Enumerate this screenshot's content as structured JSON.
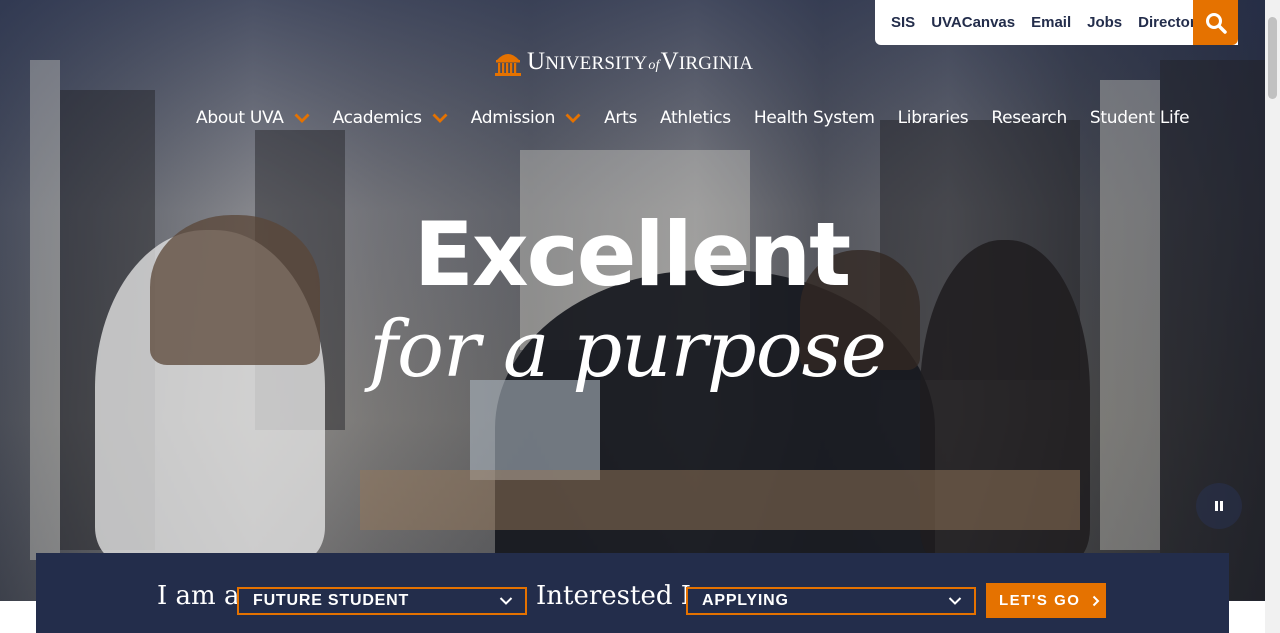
{
  "utility_nav": {
    "links": [
      "SIS",
      "UVACanvas",
      "Email",
      "Jobs",
      "Directory"
    ],
    "search_icon": "search-icon"
  },
  "logo": {
    "part1_big": "U",
    "part1_small": "NIVERSITY",
    "of": "of",
    "part2_big": "V",
    "part2_small": "IRGINIA"
  },
  "main_nav": {
    "items": [
      {
        "label": "About UVA",
        "has_dropdown": true
      },
      {
        "label": "Academics",
        "has_dropdown": true
      },
      {
        "label": "Admission",
        "has_dropdown": true
      },
      {
        "label": "Arts",
        "has_dropdown": false
      },
      {
        "label": "Athletics",
        "has_dropdown": false
      },
      {
        "label": "Health System",
        "has_dropdown": false
      },
      {
        "label": "Libraries",
        "has_dropdown": false
      },
      {
        "label": "Research",
        "has_dropdown": false
      },
      {
        "label": "Student Life",
        "has_dropdown": false
      }
    ]
  },
  "hero": {
    "headline_line1": "Excellent",
    "headline_line2": "for a purpose",
    "pause_icon": "pause-icon"
  },
  "selector": {
    "label_i_am": "I am a",
    "role_value": "FUTURE STUDENT",
    "label_interested": "Interested In",
    "interest_value": "APPLYING",
    "button_label": "LET'S GO"
  },
  "colors": {
    "navy": "#232d4b",
    "orange": "#e57200",
    "white": "#ffffff"
  }
}
